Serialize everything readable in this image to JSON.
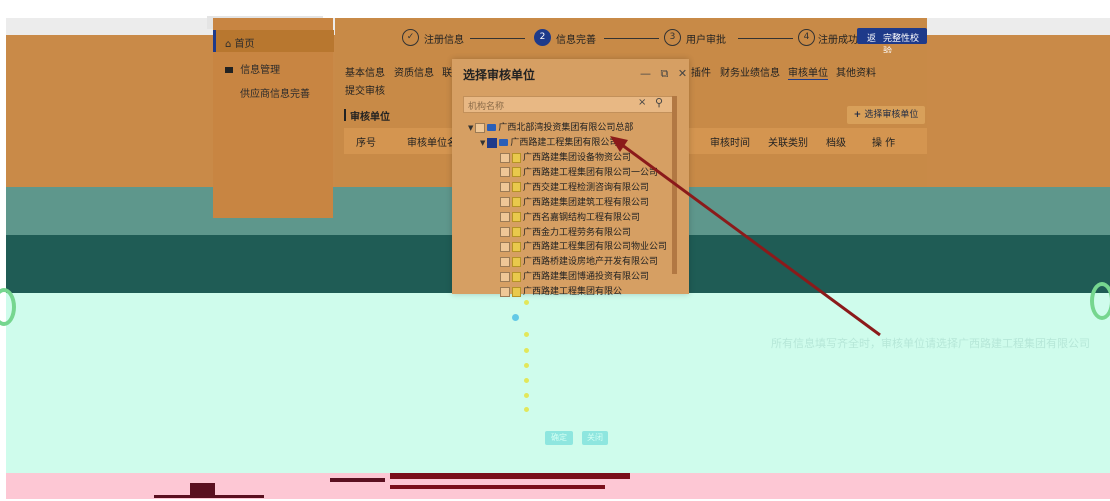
{
  "sidebar": {
    "items": [
      {
        "label": "首页",
        "icon": "home-icon"
      },
      {
        "label": "信息管理",
        "icon": "list-icon"
      },
      {
        "label": "供应商信息完善",
        "icon": ""
      }
    ]
  },
  "steps": [
    {
      "num": "",
      "label": "注册信息",
      "state": "done"
    },
    {
      "num": "2",
      "label": "信息完善",
      "state": "active"
    },
    {
      "num": "3",
      "label": "用户审批",
      "state": "todo"
    },
    {
      "num": "4",
      "label": "注册成功",
      "state": "todo"
    }
  ],
  "top_button": "完整性校验",
  "top_button_prefix": "返",
  "tabs": [
    "基本信息",
    "资质信息",
    "联",
    "插件",
    "财务业绩信息",
    "审核单位",
    "其他资料"
  ],
  "active_tab": "审核单位",
  "submit_link": "提交审核",
  "section_title": "审核单位",
  "add_button": "选择审核单位",
  "table_headers": [
    "序号",
    "审核单位名",
    "审核时间",
    "关联类别",
    "档级",
    "操 作"
  ],
  "modal": {
    "title": "选择审核单位",
    "controls": "— ⧉ ✕",
    "search_placeholder": "机构名称",
    "tree": {
      "root": "广西北部湾投资集团有限公司总部",
      "checked_node": "广西路建工程集团有限公司",
      "children": [
        "广西路建集团设备物资公司",
        "广西路建工程集团有限公司一公司",
        "广西交建工程检测咨询有限公司",
        "广西路建集团建筑工程有限公司",
        "广西名嘉钢结构工程有限公司",
        "广西金力工程劳务有限公司",
        "广西路建工程集团有限公司物业公司",
        "广西路桥建设房地产开发有限公司",
        "广西路建集团博通投资有限公司",
        "广西路建工程集团有限公"
      ]
    },
    "ok_button": "确定",
    "cancel_button": "关闭"
  },
  "annotation": "所有信息填写齐全时，审核单位请选择广西路建工程集团有限公司",
  "colors": {
    "accent": "#1e3a8a",
    "arrow": "#8b1a1a",
    "orange_bg": "#c98a48",
    "mint_bg": "#cffcec",
    "pink_bg": "#fdc7d4"
  }
}
